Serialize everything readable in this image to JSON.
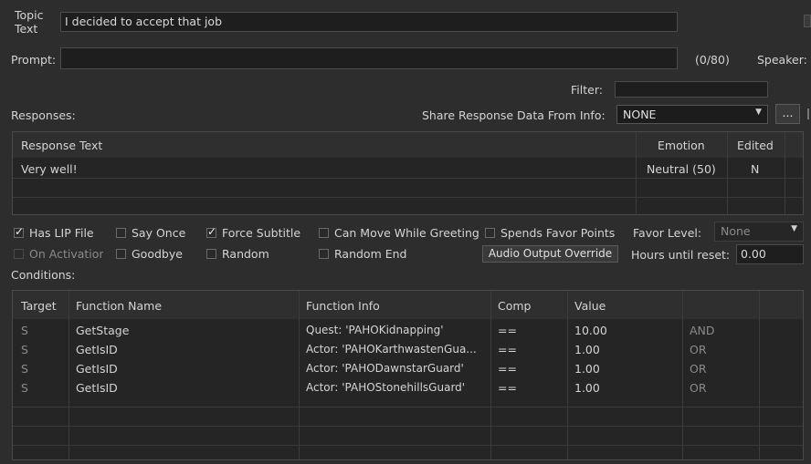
{
  "topic": {
    "label_line1": "Topic",
    "label_line2": "Text",
    "value": "I decided to accept that job"
  },
  "prompt": {
    "label": "Prompt:",
    "value": "",
    "counter": "(0/80)",
    "speaker_label": "Speaker:"
  },
  "filter": {
    "label": "Filter:",
    "value": ""
  },
  "responses": {
    "label": "Responses:",
    "share_label": "Share Response Data From Info:",
    "share_value": "NONE",
    "browse_label": "...",
    "columns": [
      "Response Text",
      "Emotion",
      "Edited"
    ],
    "rows": [
      {
        "text": "Very well!",
        "emotion": "Neutral (50)",
        "edited": "N"
      }
    ]
  },
  "flags": {
    "has_lip": {
      "label": "Has LIP File",
      "checked": true
    },
    "say_once": {
      "label": "Say Once",
      "checked": false
    },
    "force_subtitle": {
      "label": "Force Subtitle",
      "checked": true
    },
    "can_move": {
      "label": "Can Move While Greeting",
      "checked": false
    },
    "spends_favor": {
      "label": "Spends Favor Points",
      "checked": false
    },
    "on_activation": {
      "label": "On Activation",
      "checked": false
    },
    "goodbye": {
      "label": "Goodbye",
      "checked": false
    },
    "random": {
      "label": "Random",
      "checked": false
    },
    "random_end": {
      "label": "Random End",
      "checked": false
    }
  },
  "favor_level": {
    "label": "Favor Level:",
    "value": "None"
  },
  "audio_override": {
    "label": "Audio Output Override"
  },
  "hours_reset": {
    "label": "Hours until reset:",
    "value": "0.00"
  },
  "conditions": {
    "label": "Conditions:",
    "columns": [
      "Target",
      "Function Name",
      "Function Info",
      "Comp",
      "Value",
      ""
    ],
    "rows": [
      {
        "target": "S",
        "function": "GetStage",
        "info": "Quest: 'PAHOKidnapping'",
        "comp": "==",
        "value": "10.00",
        "logic": "AND"
      },
      {
        "target": "S",
        "function": "GetIsID",
        "info": "Actor: 'PAHOKarthwastenGua...",
        "comp": "==",
        "value": "1.00",
        "logic": "OR"
      },
      {
        "target": "S",
        "function": "GetIsID",
        "info": "Actor: 'PAHODawnstarGuard'",
        "comp": "==",
        "value": "1.00",
        "logic": "OR"
      },
      {
        "target": "S",
        "function": "GetIsID",
        "info": "Actor: 'PAHOStonehillsGuard'",
        "comp": "==",
        "value": "1.00",
        "logic": "OR"
      }
    ]
  }
}
